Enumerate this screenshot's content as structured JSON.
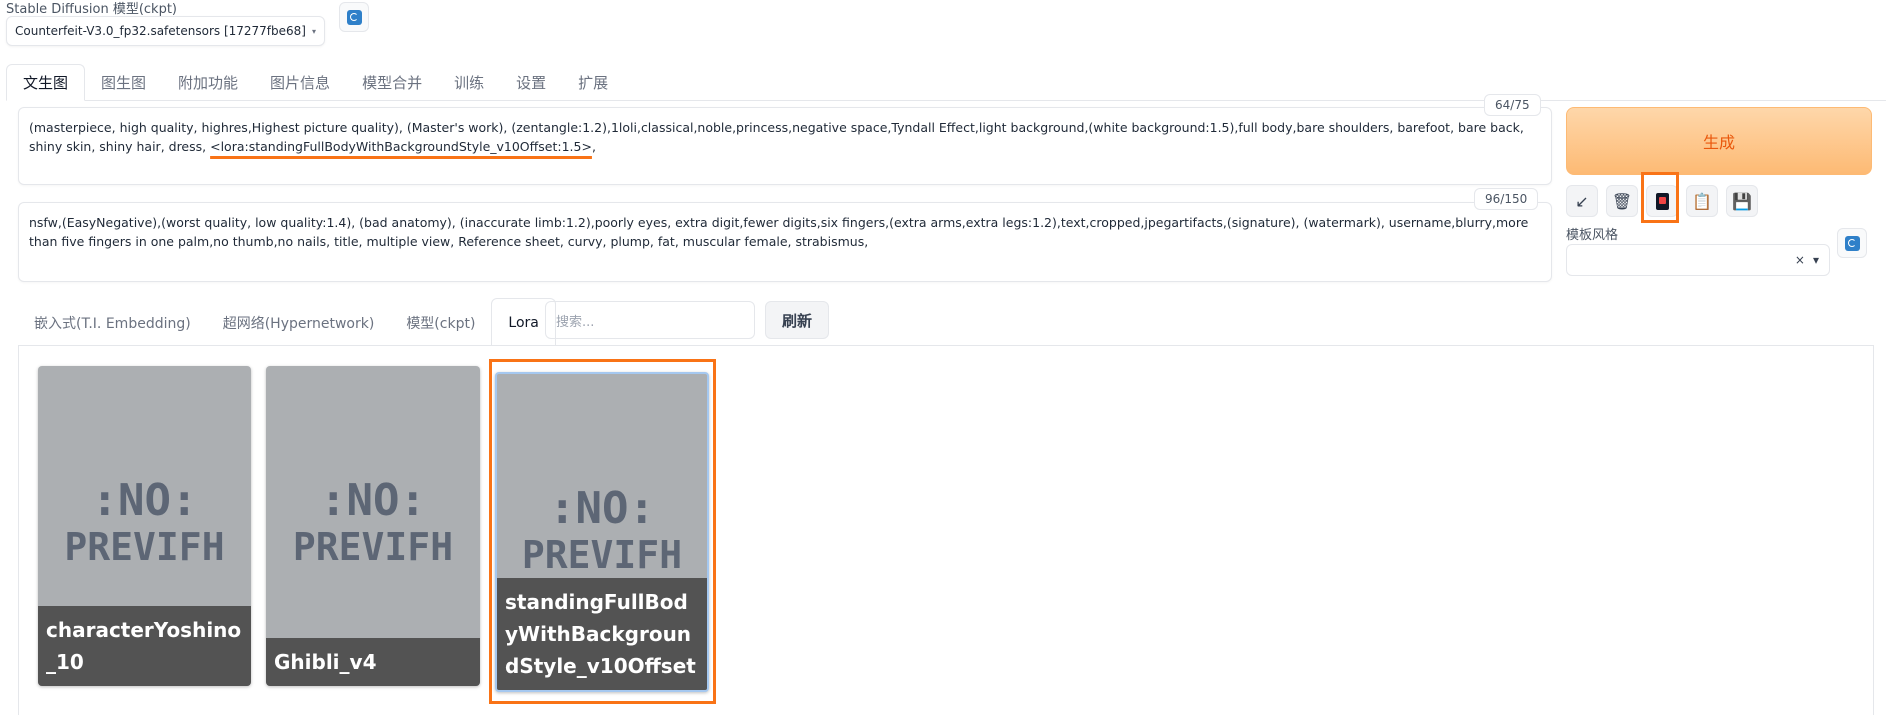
{
  "model": {
    "label": "Stable Diffusion 模型(ckpt)",
    "value": "Counterfeit-V3.0_fp32.safetensors [17277fbe68]"
  },
  "main_tabs": [
    "文生图",
    "图生图",
    "附加功能",
    "图片信息",
    "模型合并",
    "训练",
    "设置",
    "扩展"
  ],
  "positive_prompt": {
    "text": "(masterpiece, high quality, highres,Highest picture quality), (Master's work), (zentangle:1.2),1loli,classical,noble,princess,negative space,Tyndall Effect,light background,(white background:1.5),full body,bare shoulders, barefoot, bare back, shiny skin, shiny hair, dress,",
    "lora_token": "<lora:standingFullBodyWithBackgroundStyle_v10Offset:1.5>",
    "after": ",",
    "counter": "64/75"
  },
  "negative_prompt": {
    "text": "nsfw,(EasyNegative),(worst quality, low quality:1.4), (bad anatomy), (inaccurate limb:1.2),poorly eyes, extra digit,fewer digits,six fingers,(extra arms,extra legs:1.2),text,cropped,jpegartifacts,(signature), (watermark), username,blurry,more than five fingers in one palm,no thumb,no nails, title, multiple view, Reference sheet, curvy, plump, fat, muscular female, strabismus,",
    "counter": "96/150"
  },
  "generate_label": "生成",
  "tools": {
    "arrow": "↙",
    "trash": "🗑",
    "paste": "📋",
    "save": "💾"
  },
  "style": {
    "label": "模板风格",
    "clear": "×",
    "arrow": "▾"
  },
  "network_tabs": [
    "嵌入式(T.I. Embedding)",
    "超网络(Hypernetwork)",
    "模型(ckpt)",
    "Lora"
  ],
  "network_search_placeholder": "搜索...",
  "network_refresh_label": "刷新",
  "cards": [
    {
      "name": "characterYoshino_10",
      "preview_line1": ":NO:",
      "preview_line2": "PREVIFH"
    },
    {
      "name": "Ghibli_v4",
      "preview_line1": ":NO:",
      "preview_line2": "PREVIFH"
    },
    {
      "name": "standingFullBodyWithBackgroundStyle_v10Offset",
      "preview_line1": ":NO:",
      "preview_line2": "PREVIFH"
    }
  ],
  "colors": {
    "accent": "#f97316",
    "generate_bg": "#fdba74",
    "generate_text": "#ea580c"
  }
}
